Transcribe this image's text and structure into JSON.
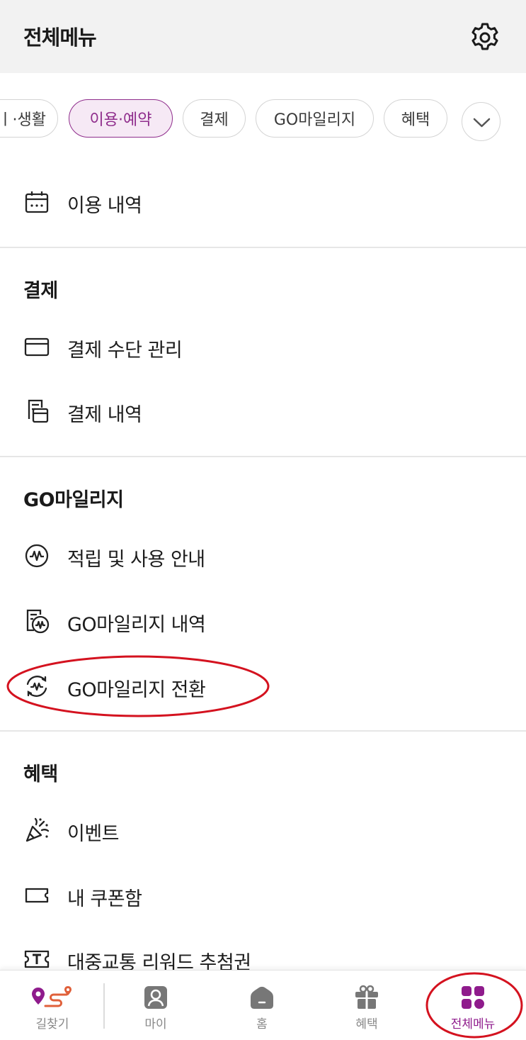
{
  "header": {
    "title": "전체메뉴",
    "settings_icon": "gear-icon"
  },
  "chips": [
    {
      "label": "ㅣ·생활"
    },
    {
      "label": "이용·예약",
      "active": true
    },
    {
      "label": "결제"
    },
    {
      "label": "GO마일리지"
    },
    {
      "label": "혜택"
    }
  ],
  "usage": {
    "items": [
      {
        "label": "이용 내역",
        "icon": "calendar-icon"
      }
    ]
  },
  "payment": {
    "title": "결제",
    "items": [
      {
        "label": "결제 수단 관리",
        "icon": "card-icon"
      },
      {
        "label": "결제 내역",
        "icon": "receipt-icon"
      }
    ]
  },
  "mileage": {
    "title": "GO마일리지",
    "items": [
      {
        "label": "적립 및 사용 안내",
        "icon": "mileage-coin-icon"
      },
      {
        "label": "GO마일리지 내역",
        "icon": "mileage-history-icon"
      },
      {
        "label": "GO마일리지 전환",
        "icon": "mileage-convert-icon"
      }
    ]
  },
  "benefits": {
    "title": "혜택",
    "items": [
      {
        "label": "이벤트",
        "icon": "party-popper-icon"
      },
      {
        "label": "내 쿠폰함",
        "icon": "coupon-icon"
      },
      {
        "label": "대중교통 리워드 추첨권",
        "icon": "ticket-icon"
      }
    ]
  },
  "bottom_nav": [
    {
      "label": "길찾기",
      "icon": "route-icon"
    },
    {
      "label": "마이",
      "icon": "profile-icon"
    },
    {
      "label": "홈",
      "icon": "home-icon"
    },
    {
      "label": "혜택",
      "icon": "gift-icon"
    },
    {
      "label": "전체메뉴",
      "icon": "grid-menu-icon",
      "active": true
    }
  ],
  "colors": {
    "accent": "#8f2d8c",
    "annotation": "#d4121f",
    "header_bg": "#f2f2f2"
  }
}
